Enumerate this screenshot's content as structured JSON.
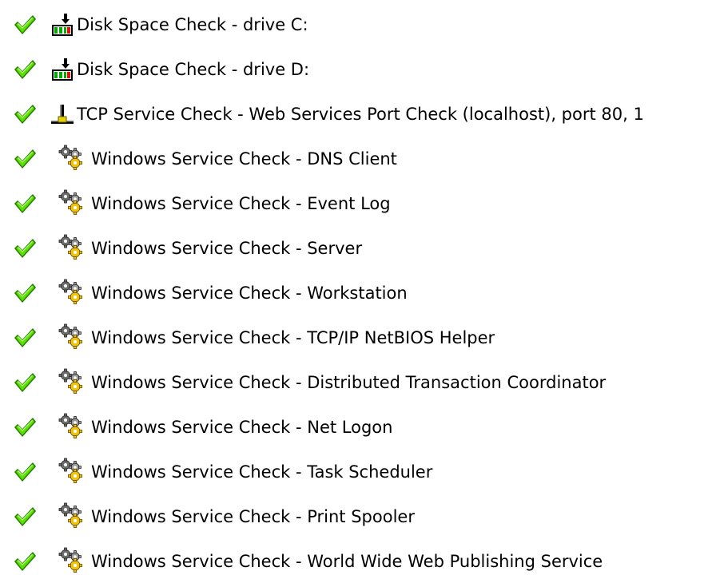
{
  "colors": {
    "check_green": "#58e000",
    "check_outline": "#1f7a00",
    "gear_gray": "#6e6e6e",
    "gear_yellow": "#f2c200",
    "disk_green": "#00a800",
    "disk_red": "#e01010",
    "text": "#000000"
  },
  "items": [
    {
      "status_icon": "check-icon",
      "type_icon": "disk-icon",
      "label": "Disk Space Check - drive C:"
    },
    {
      "status_icon": "check-icon",
      "type_icon": "disk-icon",
      "label": "Disk Space Check - drive D:"
    },
    {
      "status_icon": "check-icon",
      "type_icon": "network-icon",
      "label": "TCP Service Check - Web Services Port Check (localhost), port 80, 1"
    },
    {
      "status_icon": "check-icon",
      "type_icon": "gears-icon",
      "label": "Windows Service Check - DNS Client"
    },
    {
      "status_icon": "check-icon",
      "type_icon": "gears-icon",
      "label": "Windows Service Check - Event Log"
    },
    {
      "status_icon": "check-icon",
      "type_icon": "gears-icon",
      "label": "Windows Service Check - Server"
    },
    {
      "status_icon": "check-icon",
      "type_icon": "gears-icon",
      "label": "Windows Service Check - Workstation"
    },
    {
      "status_icon": "check-icon",
      "type_icon": "gears-icon",
      "label": "Windows Service Check - TCP/IP NetBIOS Helper"
    },
    {
      "status_icon": "check-icon",
      "type_icon": "gears-icon",
      "label": "Windows Service Check - Distributed Transaction Coordinator"
    },
    {
      "status_icon": "check-icon",
      "type_icon": "gears-icon",
      "label": "Windows Service Check - Net Logon"
    },
    {
      "status_icon": "check-icon",
      "type_icon": "gears-icon",
      "label": "Windows Service Check - Task Scheduler"
    },
    {
      "status_icon": "check-icon",
      "type_icon": "gears-icon",
      "label": "Windows Service Check - Print Spooler"
    },
    {
      "status_icon": "check-icon",
      "type_icon": "gears-icon",
      "label": "Windows Service Check - World Wide Web Publishing Service"
    }
  ]
}
